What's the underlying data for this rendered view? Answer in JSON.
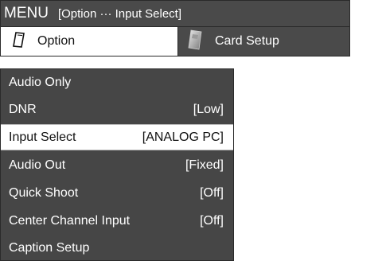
{
  "header": {
    "menu_label": "MENU",
    "breadcrumb": "[Option ··· Input Select]"
  },
  "tabs": [
    {
      "label": "Option",
      "icon": "option-card-icon",
      "active": true
    },
    {
      "label": "Card Setup",
      "icon": "card-setup-icon",
      "active": false
    }
  ],
  "menu": {
    "items": [
      {
        "label": "Audio Only",
        "value": ""
      },
      {
        "label": "DNR",
        "value": "[Low]"
      },
      {
        "label": "Input Select",
        "value": "[ANALOG PC]",
        "selected": true
      },
      {
        "label": "Audio Out",
        "value": "[Fixed]"
      },
      {
        "label": "Quick Shoot",
        "value": "[Off]"
      },
      {
        "label": "Center Channel Input",
        "value": "[Off]"
      },
      {
        "label": "Caption Setup",
        "value": ""
      }
    ]
  },
  "colors": {
    "panel_dark": "#464646",
    "title_bar": "#4a4a4a",
    "highlight": "#ffffff"
  }
}
